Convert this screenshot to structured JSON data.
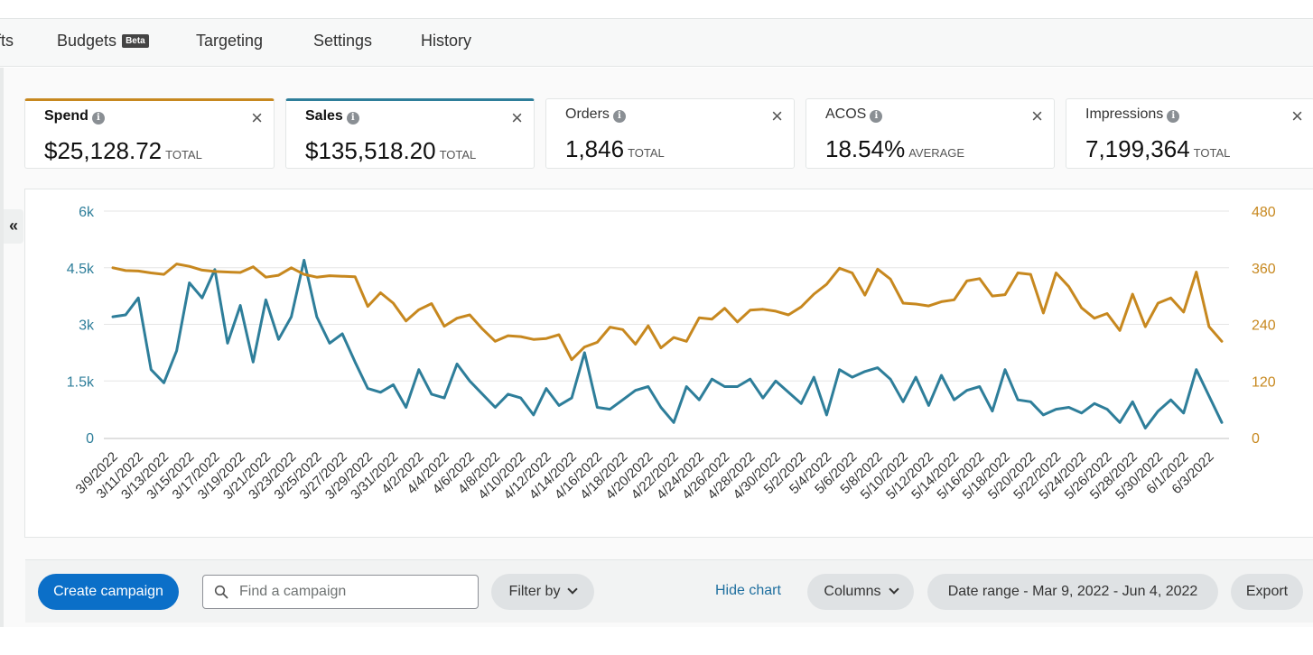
{
  "nav": {
    "items": [
      {
        "label": "fts"
      },
      {
        "label": "Budgets",
        "badge": "Beta"
      },
      {
        "label": "Targeting"
      },
      {
        "label": "Settings"
      },
      {
        "label": "History"
      }
    ]
  },
  "metrics": [
    {
      "title": "Spend",
      "value": "$25,128.72",
      "agg": "TOTAL",
      "active": true,
      "color": "#c7881f"
    },
    {
      "title": "Sales",
      "value": "$135,518.20",
      "agg": "TOTAL",
      "active": true,
      "color": "#2e7e9a"
    },
    {
      "title": "Orders",
      "value": "1,846",
      "agg": "TOTAL",
      "active": false
    },
    {
      "title": "ACOS",
      "value": "18.54%",
      "agg": "AVERAGE",
      "active": false
    },
    {
      "title": "Impressions",
      "value": "7,199,364",
      "agg": "TOTAL",
      "active": false
    }
  ],
  "icons": {
    "info": "i",
    "close": "×",
    "collapse": "«"
  },
  "chart_data": {
    "type": "line",
    "x": [
      "3/9/2022",
      "3/10/2022",
      "3/11/2022",
      "3/12/2022",
      "3/13/2022",
      "3/14/2022",
      "3/15/2022",
      "3/16/2022",
      "3/17/2022",
      "3/18/2022",
      "3/19/2022",
      "3/20/2022",
      "3/21/2022",
      "3/22/2022",
      "3/23/2022",
      "3/24/2022",
      "3/25/2022",
      "3/26/2022",
      "3/27/2022",
      "3/28/2022",
      "3/29/2022",
      "3/30/2022",
      "3/31/2022",
      "4/1/2022",
      "4/2/2022",
      "4/3/2022",
      "4/4/2022",
      "4/5/2022",
      "4/6/2022",
      "4/7/2022",
      "4/8/2022",
      "4/9/2022",
      "4/10/2022",
      "4/11/2022",
      "4/12/2022",
      "4/13/2022",
      "4/14/2022",
      "4/15/2022",
      "4/16/2022",
      "4/17/2022",
      "4/18/2022",
      "4/19/2022",
      "4/20/2022",
      "4/21/2022",
      "4/22/2022",
      "4/23/2022",
      "4/24/2022",
      "4/25/2022",
      "4/26/2022",
      "4/27/2022",
      "4/28/2022",
      "4/29/2022",
      "4/30/2022",
      "5/1/2022",
      "5/2/2022",
      "5/3/2022",
      "5/4/2022",
      "5/5/2022",
      "5/6/2022",
      "5/7/2022",
      "5/8/2022",
      "5/9/2022",
      "5/10/2022",
      "5/11/2022",
      "5/12/2022",
      "5/13/2022",
      "5/14/2022",
      "5/15/2022",
      "5/16/2022",
      "5/17/2022",
      "5/18/2022",
      "5/19/2022",
      "5/20/2022",
      "5/21/2022",
      "5/22/2022",
      "5/23/2022",
      "5/24/2022",
      "5/25/2022",
      "5/26/2022",
      "5/27/2022",
      "5/28/2022",
      "5/29/2022",
      "5/30/2022",
      "5/31/2022",
      "6/1/2022",
      "6/2/2022",
      "6/3/2022",
      "6/4/2022"
    ],
    "x_tick_labels": [
      "3/9/2022",
      "3/11/2022",
      "3/13/2022",
      "3/15/2022",
      "3/17/2022",
      "3/19/2022",
      "3/21/2022",
      "3/23/2022",
      "3/25/2022",
      "3/27/2022",
      "3/29/2022",
      "3/31/2022",
      "4/2/2022",
      "4/4/2022",
      "4/6/2022",
      "4/8/2022",
      "4/10/2022",
      "4/12/2022",
      "4/14/2022",
      "4/16/2022",
      "4/18/2022",
      "4/20/2022",
      "4/22/2022",
      "4/24/2022",
      "4/26/2022",
      "4/28/2022",
      "4/30/2022",
      "5/2/2022",
      "5/4/2022",
      "5/6/2022",
      "5/8/2022",
      "5/10/2022",
      "5/12/2022",
      "5/14/2022",
      "5/16/2022",
      "5/18/2022",
      "5/20/2022",
      "5/22/2022",
      "5/24/2022",
      "5/26/2022",
      "5/28/2022",
      "5/30/2022",
      "6/1/2022",
      "6/3/2022"
    ],
    "y_left": {
      "ticks": [
        "0",
        "1.5k",
        "3k",
        "4.5k",
        "6k"
      ],
      "ylim": [
        0,
        6000
      ],
      "color": "#2e7e9a"
    },
    "y_right": {
      "ticks": [
        "0",
        "120",
        "240",
        "360",
        "480"
      ],
      "ylim": [
        0,
        480
      ],
      "color": "#c7881f"
    },
    "grid": true,
    "series": [
      {
        "name": "Sales",
        "axis": "left",
        "color": "#2e7e9a",
        "values": [
          3200,
          3250,
          3700,
          1800,
          1450,
          2300,
          4100,
          3700,
          4450,
          2500,
          3500,
          2000,
          3650,
          2600,
          3200,
          4700,
          3200,
          2500,
          2750,
          2000,
          1300,
          1200,
          1400,
          800,
          1800,
          1150,
          1050,
          1950,
          1500,
          1150,
          800,
          1150,
          1050,
          600,
          1300,
          850,
          1050,
          2250,
          800,
          750,
          1000,
          1250,
          1350,
          800,
          400,
          1350,
          1000,
          1550,
          1350,
          1350,
          1550,
          1050,
          1500,
          1200,
          900,
          1600,
          600,
          1800,
          1600,
          1750,
          1850,
          1550,
          950,
          1600,
          850,
          1650,
          1000,
          1250,
          1350,
          700,
          1800,
          1000,
          950,
          600,
          750,
          800,
          650,
          900,
          750,
          400,
          950,
          250,
          700,
          1000,
          650,
          1800,
          1100,
          400
        ]
      },
      {
        "name": "Spend",
        "axis": "right",
        "color": "#c7881f",
        "values": [
          360,
          354,
          353,
          349,
          346,
          368,
          363,
          355,
          352,
          351,
          350,
          362,
          340,
          344,
          360,
          346,
          340,
          343,
          342,
          341,
          278,
          307,
          285,
          247,
          271,
          284,
          236,
          253,
          260,
          230,
          204,
          216,
          214,
          208,
          210,
          218,
          165,
          192,
          202,
          234,
          229,
          198,
          237,
          190,
          212,
          204,
          254,
          251,
          274,
          245,
          270,
          272,
          268,
          260,
          277,
          304,
          325,
          359,
          349,
          302,
          357,
          336,
          285,
          283,
          279,
          288,
          292,
          332,
          337,
          300,
          303,
          349,
          346,
          264,
          349,
          320,
          275,
          253,
          263,
          227,
          304,
          235,
          285,
          296,
          266,
          351,
          235,
          204
        ]
      }
    ]
  },
  "toolbar": {
    "create_label": "Create campaign",
    "search_placeholder": "Find a campaign",
    "filter_label": "Filter by",
    "hide_chart_label": "Hide chart",
    "columns_label": "Columns",
    "date_range_label": "Date range - Mar 9, 2022 - Jun 4, 2022",
    "export_label": "Export"
  }
}
